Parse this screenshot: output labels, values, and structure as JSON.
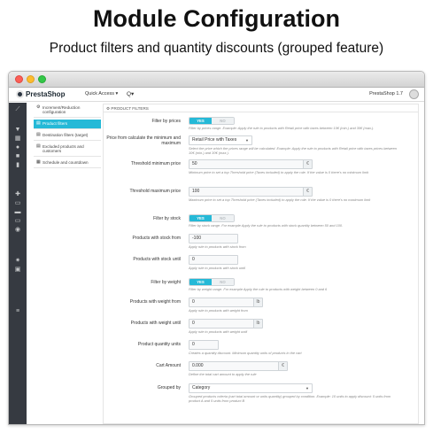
{
  "hero": {
    "title": "Module Configuration",
    "subtitle": "Product filters and quantity discounts (grouped feature)"
  },
  "topbar": {
    "logo": "PrestaShop",
    "quick_access": "Quick Access ▾",
    "search_icon": "Q▾",
    "version": "PrestaShop 1.7"
  },
  "sidebar_icons": [
    "chart-icon",
    "cart-icon",
    "store-icon",
    "user-icon",
    "chat-icon",
    "stats-icon",
    "puzzle-icon",
    "monitor-icon",
    "truck-icon",
    "card-icon",
    "globe-icon",
    "gear-icon",
    "info-icon",
    "menu-icon"
  ],
  "tabs": [
    {
      "label": "Increment/Reduction configuration",
      "icon": "⚙"
    },
    {
      "label": "Product filters",
      "icon": "▤"
    },
    {
      "label": "Destination filters (target)",
      "icon": "▤"
    },
    {
      "label": "Excluded products and customers",
      "icon": "▤"
    },
    {
      "label": "Schedule and countdown",
      "icon": "▦"
    }
  ],
  "panel": {
    "title": "PRODUCT FILTERS",
    "title_icon": "⚙"
  },
  "form": {
    "filter_prices": {
      "label": "Filter by prices",
      "yes": "YES",
      "no": "NO",
      "help": "Filter by prices range. Example: Apply the rule to products with Retail price with taxes between 10€ (min.) and 30€ (max.)."
    },
    "price_calc": {
      "label": "Price from calculate the minimum and maximum",
      "value": "Retail Price with Taxes",
      "help": "Select the price which the prices range will be calculated. Example: Apply the rule to products with Retail price with taxes prices between 10€ (min.) and 30€ (max.)."
    },
    "threshold_min": {
      "label": "Threshold minimum price",
      "value": "50",
      "addon": "€",
      "help": "Minimum price to set a top Threshold price (Taxes included) to apply the rule. If the value is 0 there's no minimum limit"
    },
    "threshold_max": {
      "label": "Threshold maximum price",
      "value": "100",
      "addon": "€",
      "help": "Maximum price to set a top Threshold price (Taxes included) to apply the rule. If the value is 0 there's no maximum limit"
    },
    "filter_stock": {
      "label": "Filter by stock",
      "yes": "YES",
      "no": "NO",
      "help": "Filter by stock range. For example Apply the rule to products with stock quantity between 50 and 100."
    },
    "stock_from": {
      "label": "Products with stock from",
      "value": "-100",
      "help": "Apply rule to products with stock from"
    },
    "stock_until": {
      "label": "Products with stock until",
      "value": "0",
      "help": "Apply rule to products with stock until"
    },
    "filter_weight": {
      "label": "Filter by weight",
      "yes": "YES",
      "no": "NO",
      "help": "Filter by weight range. For example Apply the rule to products with weight between 0 and 6"
    },
    "weight_from": {
      "label": "Products with weight from",
      "value": "0",
      "addon": "lb",
      "help": "Apply rule to products with weight from"
    },
    "weight_until": {
      "label": "Products with weight until",
      "value": "0",
      "addon": "lb",
      "help": "Apply rule to products with weight until"
    },
    "qty_units": {
      "label": "Product quantity units",
      "value": "0",
      "help": "Creates a quantity discount. Minimum quantity units of products in the cart"
    },
    "cart_amount": {
      "label": "Cart Amount",
      "value": "0.000",
      "addon": "€",
      "help": "Define the total cart amount to apply the rule"
    },
    "grouped_by": {
      "label": "Grouped by",
      "value": "Category",
      "help": "Grouped products criteria (cart total amount or units quantity) grouped by condition. Example: 10 units to apply discount: 5 units from product A and 5 units from product B"
    }
  }
}
